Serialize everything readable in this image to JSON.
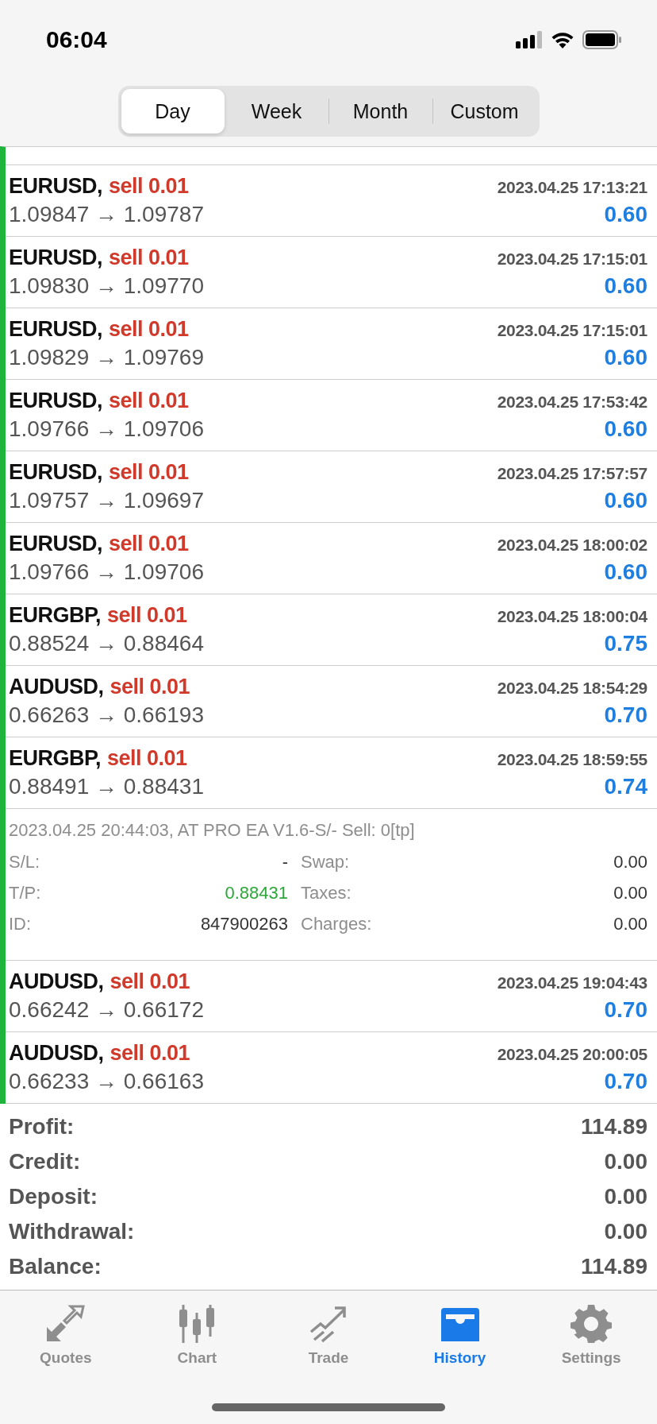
{
  "status_bar": {
    "time": "06:04"
  },
  "period_tabs": [
    {
      "label": "Day",
      "selected": true
    },
    {
      "label": "Week",
      "selected": false
    },
    {
      "label": "Month",
      "selected": false
    },
    {
      "label": "Custom",
      "selected": false
    }
  ],
  "deals": [
    {
      "symbol": "EURUSD,",
      "side": "sell 0.01",
      "time": "2023.04.25 17:13:21",
      "prices": "1.09847 → 1.09787",
      "profit": "0.60"
    },
    {
      "symbol": "EURUSD,",
      "side": "sell 0.01",
      "time": "2023.04.25 17:15:01",
      "prices": "1.09830 → 1.09770",
      "profit": "0.60"
    },
    {
      "symbol": "EURUSD,",
      "side": "sell 0.01",
      "time": "2023.04.25 17:15:01",
      "prices": "1.09829 → 1.09769",
      "profit": "0.60"
    },
    {
      "symbol": "EURUSD,",
      "side": "sell 0.01",
      "time": "2023.04.25 17:53:42",
      "prices": "1.09766 → 1.09706",
      "profit": "0.60"
    },
    {
      "symbol": "EURUSD,",
      "side": "sell 0.01",
      "time": "2023.04.25 17:57:57",
      "prices": "1.09757 → 1.09697",
      "profit": "0.60"
    },
    {
      "symbol": "EURUSD,",
      "side": "sell 0.01",
      "time": "2023.04.25 18:00:02",
      "prices": "1.09766 → 1.09706",
      "profit": "0.60"
    },
    {
      "symbol": "EURGBP,",
      "side": "sell 0.01",
      "time": "2023.04.25 18:00:04",
      "prices": "0.88524 → 0.88464",
      "profit": "0.75"
    },
    {
      "symbol": "AUDUSD,",
      "side": "sell 0.01",
      "time": "2023.04.25 18:54:29",
      "prices": "0.66263 → 0.66193",
      "profit": "0.70"
    },
    {
      "symbol": "EURGBP,",
      "side": "sell 0.01",
      "time": "2023.04.25 18:59:55",
      "prices": "0.88491 → 0.88431",
      "profit": "0.74",
      "details": {
        "comment": "2023.04.25 20:44:03, AT PRO EA V1.6-S/- Sell: 0[tp]",
        "left": [
          {
            "label": "S/L:",
            "value": "-",
            "kind": "plain"
          },
          {
            "label": "T/P:",
            "value": "0.88431",
            "kind": "target"
          },
          {
            "label": "ID:",
            "value": "847900263",
            "kind": "plain"
          }
        ],
        "right": [
          {
            "label": "Swap:",
            "value": "0.00"
          },
          {
            "label": "Taxes:",
            "value": "0.00"
          },
          {
            "label": "Charges:",
            "value": "0.00"
          }
        ]
      }
    },
    {
      "symbol": "AUDUSD,",
      "side": "sell 0.01",
      "time": "2023.04.25 19:04:43",
      "prices": "0.66242 → 0.66172",
      "profit": "0.70"
    },
    {
      "symbol": "AUDUSD,",
      "side": "sell 0.01",
      "time": "2023.04.25 20:00:05",
      "prices": "0.66233 → 0.66163",
      "profit": "0.70"
    }
  ],
  "summary": [
    {
      "label": "Profit:",
      "value": "114.89"
    },
    {
      "label": "Credit:",
      "value": "0.00"
    },
    {
      "label": "Deposit:",
      "value": "0.00"
    },
    {
      "label": "Withdrawal:",
      "value": "0.00"
    },
    {
      "label": "Balance:",
      "value": "114.89"
    }
  ],
  "tab_bar": [
    {
      "label": "Quotes",
      "selected": false
    },
    {
      "label": "Chart",
      "selected": false
    },
    {
      "label": "Trade",
      "selected": false
    },
    {
      "label": "History",
      "selected": true
    },
    {
      "label": "Settings",
      "selected": false
    }
  ]
}
